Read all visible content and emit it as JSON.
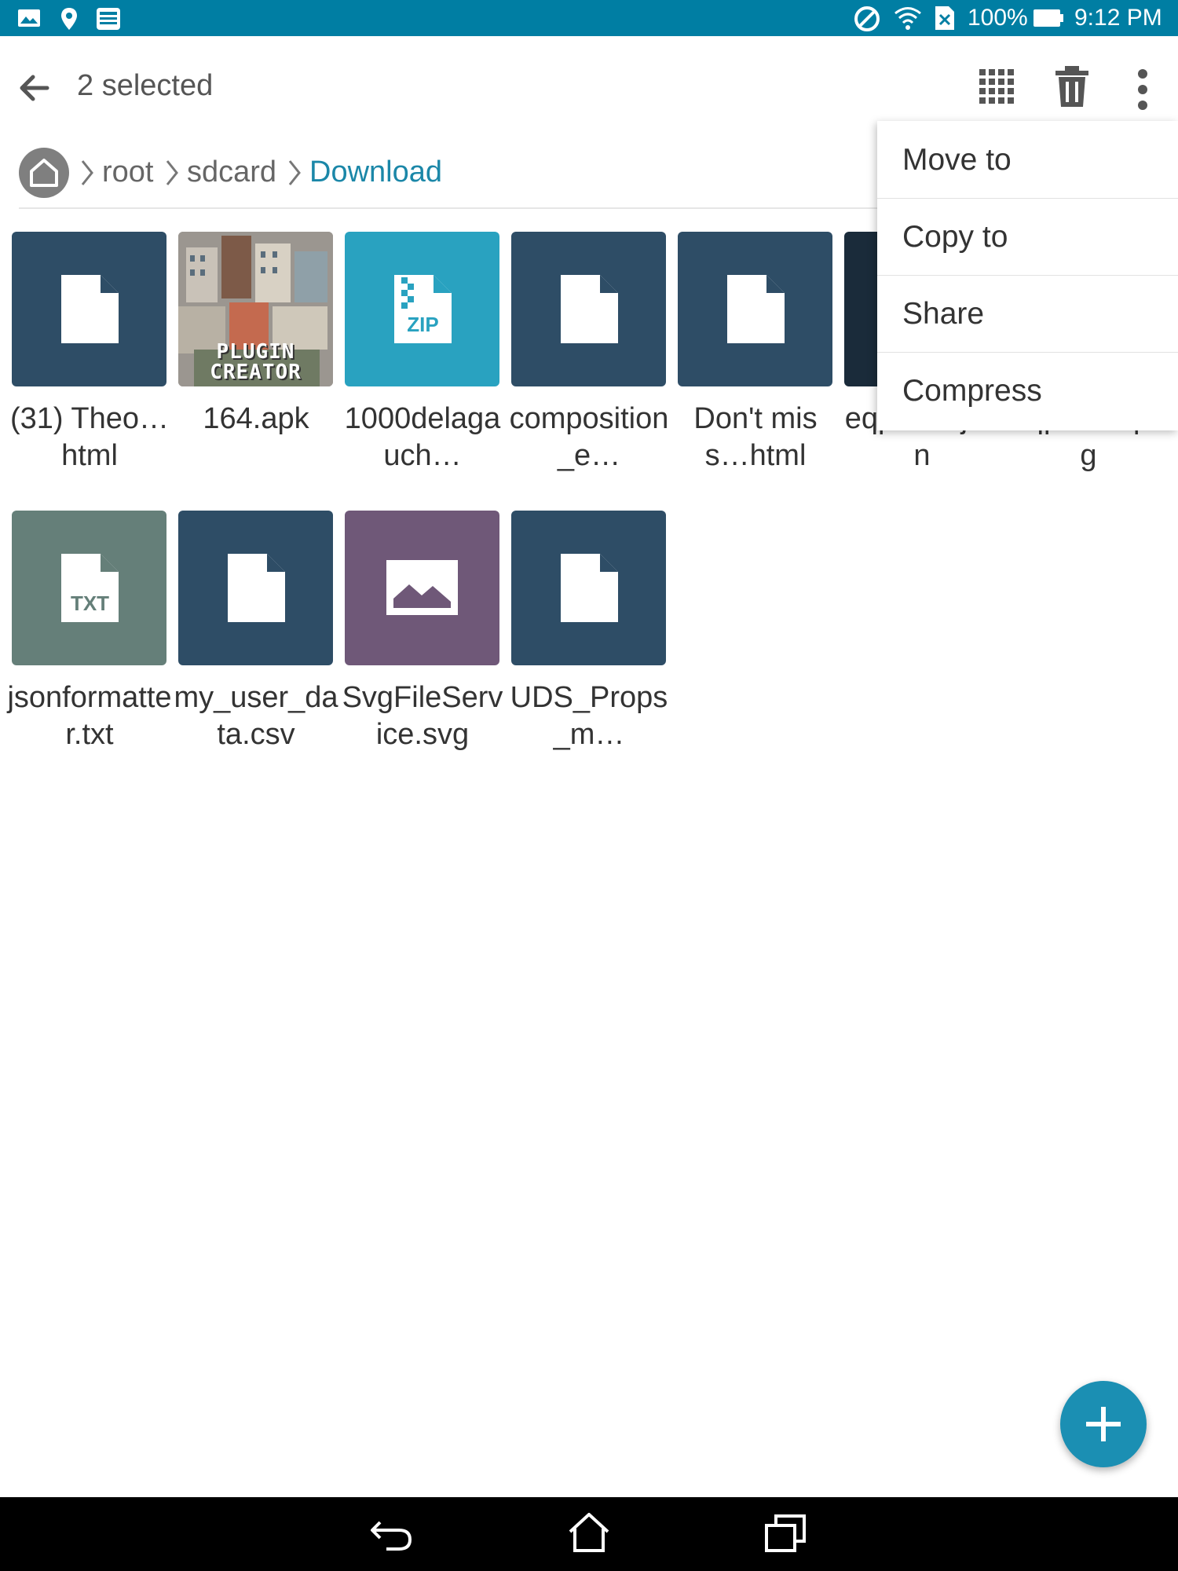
{
  "status_bar": {
    "icons_left": [
      "gallery-icon",
      "location-icon",
      "bible-app-icon"
    ],
    "icons_right": [
      "do-not-disturb-icon",
      "wifi-icon",
      "no-sim-icon",
      "battery-icon"
    ],
    "battery_level": "100%",
    "time": "9:12 PM",
    "bg_color": "#007ea3"
  },
  "app_bar": {
    "title": "2 selected",
    "actions": [
      "select-all-icon",
      "trash-icon",
      "more-vert-icon"
    ]
  },
  "breadcrumb": {
    "home_icon": "home-icon",
    "items": [
      "root",
      "sdcard",
      "Download"
    ],
    "active_color": "#1b87a8"
  },
  "files": [
    {
      "name": "(31) Theo…html",
      "type": "doc",
      "color": "#2e4d66"
    },
    {
      "name": "164.apk",
      "type": "apk-image",
      "color": "#8a8a8a"
    },
    {
      "name": "1000delagauch…",
      "type": "zip",
      "color": "#29a2c0"
    },
    {
      "name": "composition_e…",
      "type": "doc",
      "color": "#2e4d66"
    },
    {
      "name": "Don't miss…html",
      "type": "doc",
      "color": "#2e4d66"
    },
    {
      "name": "eqpfuzdrjson",
      "type": "doc",
      "color": "#1a2b3a"
    },
    {
      "name": "eqpfuzdr.png",
      "type": "doc",
      "color": "#2e4d66"
    },
    {
      "name": "jsonformatter.txt",
      "type": "txt",
      "color": "#657f79"
    },
    {
      "name": "my_user_data.csv",
      "type": "doc",
      "color": "#2e4d66"
    },
    {
      "name": "SvgFileService.svg",
      "type": "image",
      "color": "#6f5878"
    },
    {
      "name": "UDS_Props_m…",
      "type": "doc",
      "color": "#2e4d66"
    }
  ],
  "apk_thumb_text": "PLUGIN CREATOR",
  "zip_label": "ZIP",
  "txt_label": "TXT",
  "menu": {
    "items": [
      "Move to",
      "Copy to",
      "Share",
      "Compress"
    ]
  },
  "fab": {
    "icon": "plus-icon",
    "color": "#1b8fb3"
  },
  "nav_bar": {
    "icons": [
      "back-nav-icon",
      "home-nav-icon",
      "recents-nav-icon"
    ]
  }
}
